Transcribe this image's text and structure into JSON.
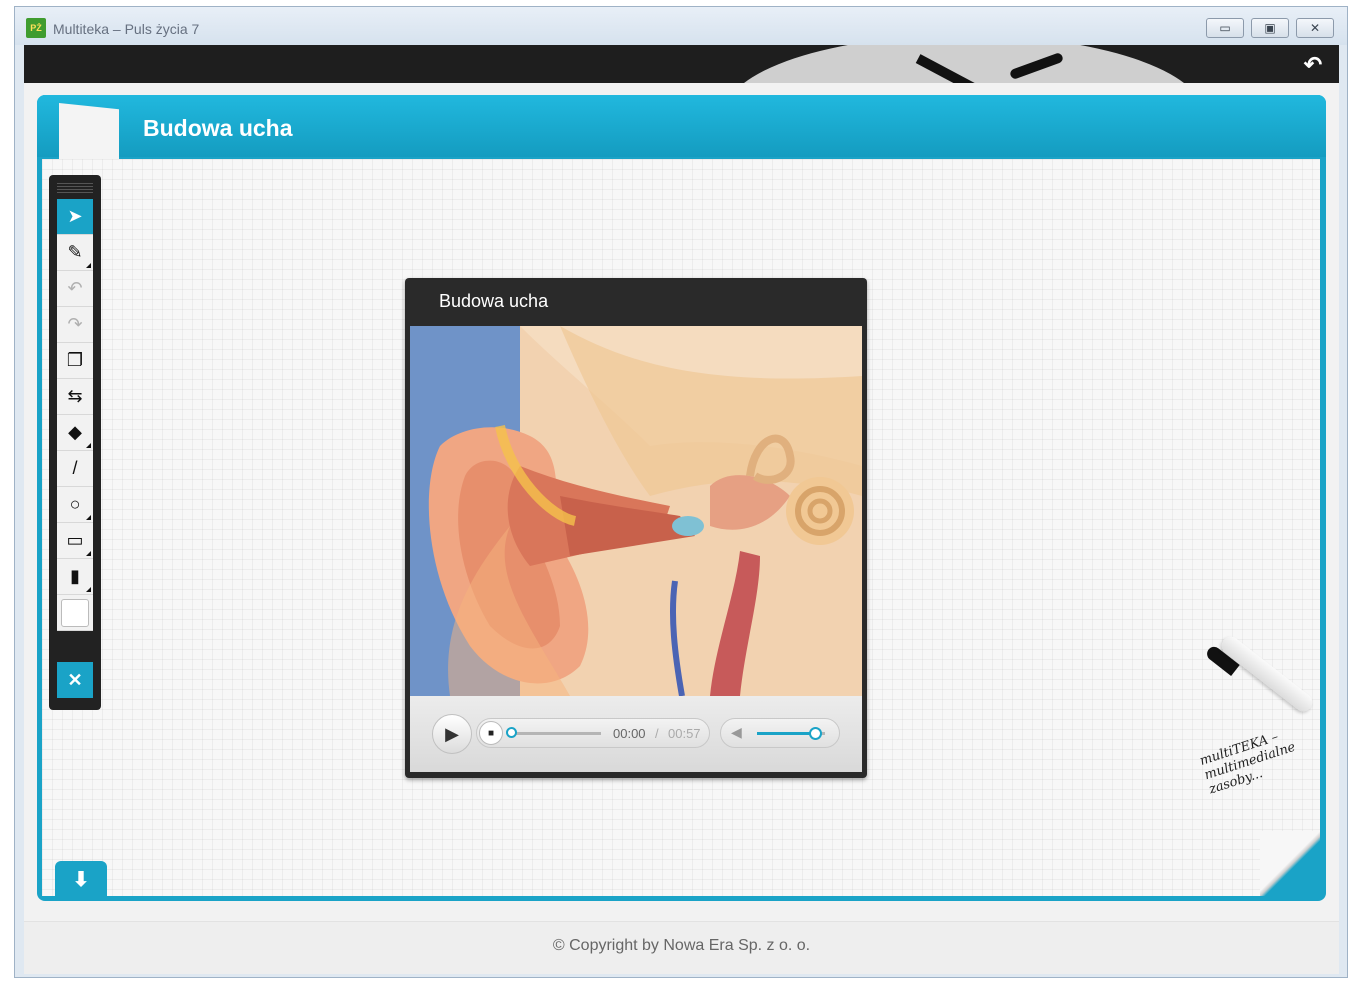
{
  "window": {
    "title": "Multiteka – Puls życia 7",
    "icon": "app-logo-icon",
    "controls": [
      "minimize-icon",
      "maximize-icon",
      "close-icon"
    ]
  },
  "topbar": {
    "back_icon": "back-arrow-icon"
  },
  "page": {
    "title": "Budowa ucha"
  },
  "toolbar": {
    "tools": [
      {
        "name": "select",
        "icon": "cursor-icon",
        "active": true
      },
      {
        "name": "pen",
        "icon": "pen-icon",
        "submenu": true
      },
      {
        "name": "undo",
        "icon": "undo-icon",
        "disabled": true
      },
      {
        "name": "redo",
        "icon": "redo-icon",
        "disabled": true
      },
      {
        "name": "copy",
        "icon": "copy-icon"
      },
      {
        "name": "move",
        "icon": "swap-icon"
      },
      {
        "name": "eraser",
        "icon": "eraser-icon",
        "submenu": true
      },
      {
        "name": "line",
        "icon": "line-icon"
      },
      {
        "name": "circle",
        "icon": "circle-icon",
        "submenu": true
      },
      {
        "name": "rectangle",
        "icon": "rectangle-icon",
        "submenu": true
      },
      {
        "name": "thickness",
        "icon": "thickness-icon",
        "submenu": true
      },
      {
        "name": "color",
        "icon": "color-swatch-icon"
      }
    ],
    "close_icon": "close-icon"
  },
  "player": {
    "title": "Budowa ucha",
    "time_current": "00:00",
    "time_separator": "/",
    "time_total": "00:57",
    "progress": 0,
    "volume": 0.85
  },
  "decoration": {
    "brand_note": "multiTEKA – multimedialne zasoby..."
  },
  "footer": {
    "copyright": "© Copyright by Nowa Era Sp. z o. o."
  },
  "colors": {
    "accent": "#1aa3c7",
    "topbar": "#1e1e1e",
    "window_frame": "#dfe8f1"
  }
}
